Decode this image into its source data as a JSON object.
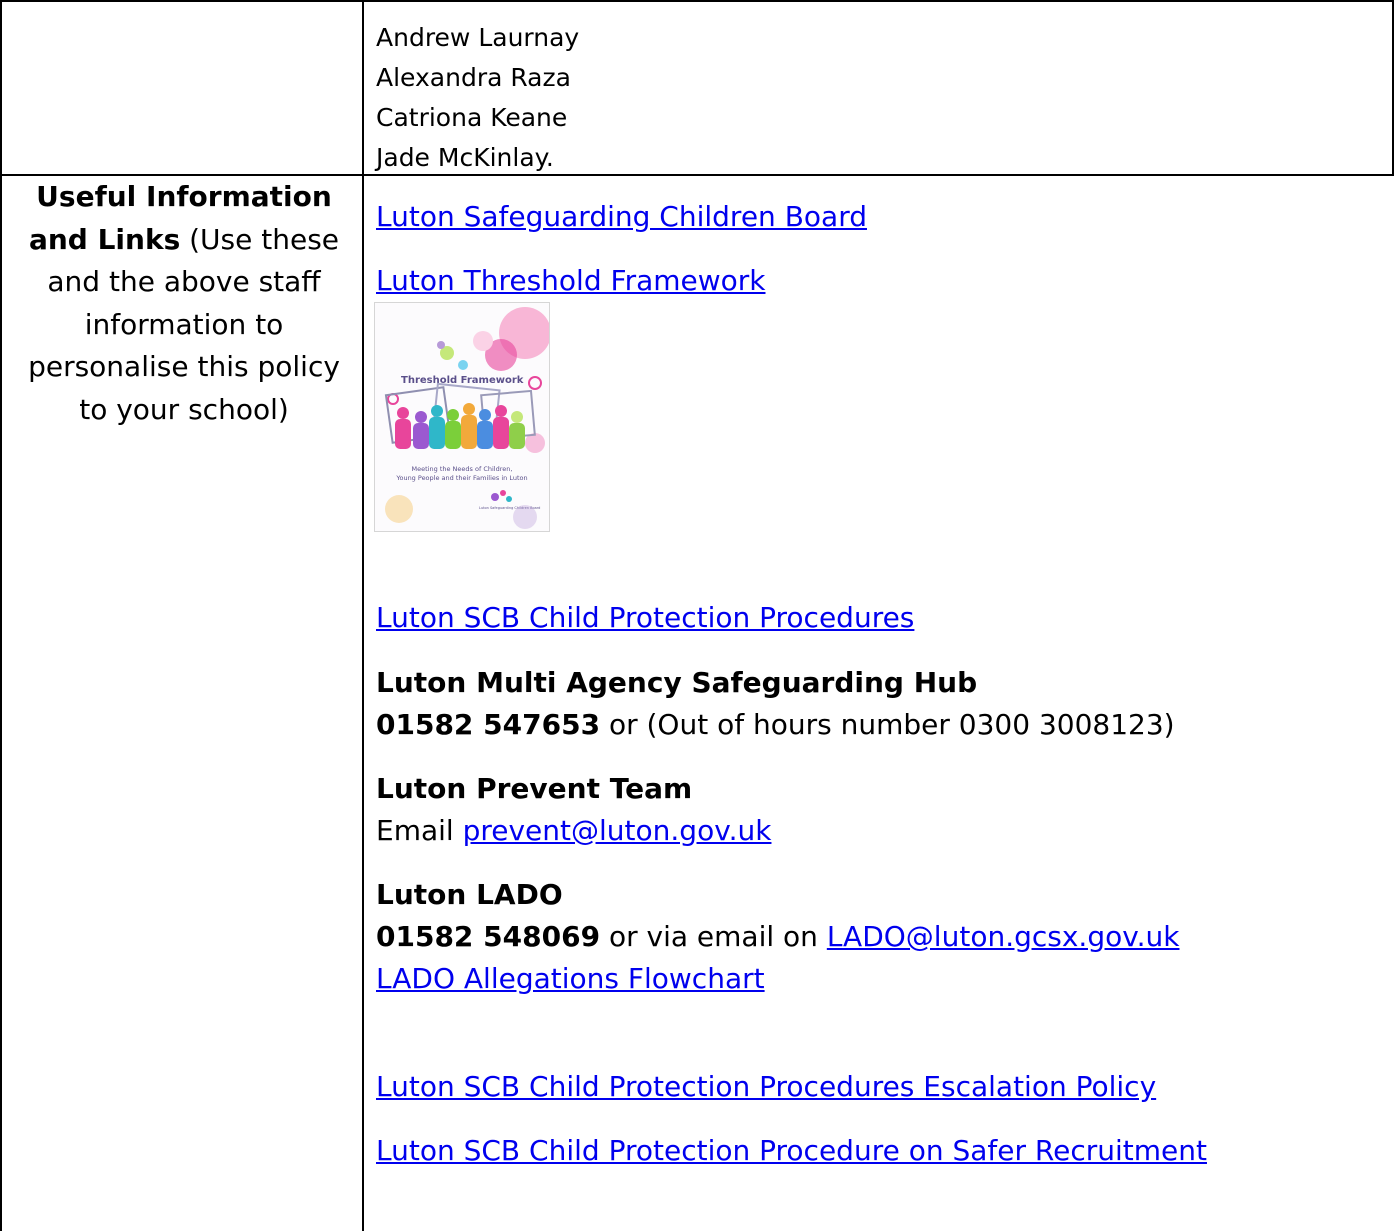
{
  "staff": [
    "Andrew Laurnay",
    "Alexandra Raza",
    "Catriona Keane",
    "Jade McKinlay."
  ],
  "left_cell": {
    "heading_bold_line1": "Useful Information",
    "heading_bold_line2": "and Links",
    "heading_rest_line2": " (Use these",
    "line3": "and the above staff",
    "line4": "information to",
    "line5": "personalise this policy",
    "line6": "to your school)"
  },
  "links": {
    "lscb": "Luton Safeguarding Children Board",
    "threshold": "Luton Threshold Framework",
    "cp_procedures": "Luton SCB Child Protection Procedures",
    "lado_flowchart": "LADO Allegations Flowchart",
    "escalation": "Luton SCB Child Protection Procedures Escalation Policy",
    "safer_recruitment": "Luton SCB Child Protection Procedure on Safer Recruitment"
  },
  "threshold_cover": {
    "title": "Threshold Framework",
    "subtitle_line1": "Meeting the Needs of Children,",
    "subtitle_line2": "Young People and their Families in Luton",
    "logo_text": "Luton Safeguarding Children Board",
    "colors": [
      "#e8459b",
      "#f29ac8",
      "#7ad3f0",
      "#c5e87a",
      "#b79ad8",
      "#f7c66b"
    ]
  },
  "mash": {
    "title": "Luton Multi Agency Safeguarding Hub",
    "phone": "01582 547653",
    "phone_suffix": " or (Out of hours number 0300 3008123)"
  },
  "prevent": {
    "title": "Luton Prevent Team",
    "email_prefix": "Email ",
    "email": "prevent@luton.gov.uk"
  },
  "lado": {
    "title": "Luton LADO",
    "phone": "01582 548069",
    "phone_suffix": " or via email on ",
    "email": "LADO@luton.gcsx.gov.uk"
  }
}
